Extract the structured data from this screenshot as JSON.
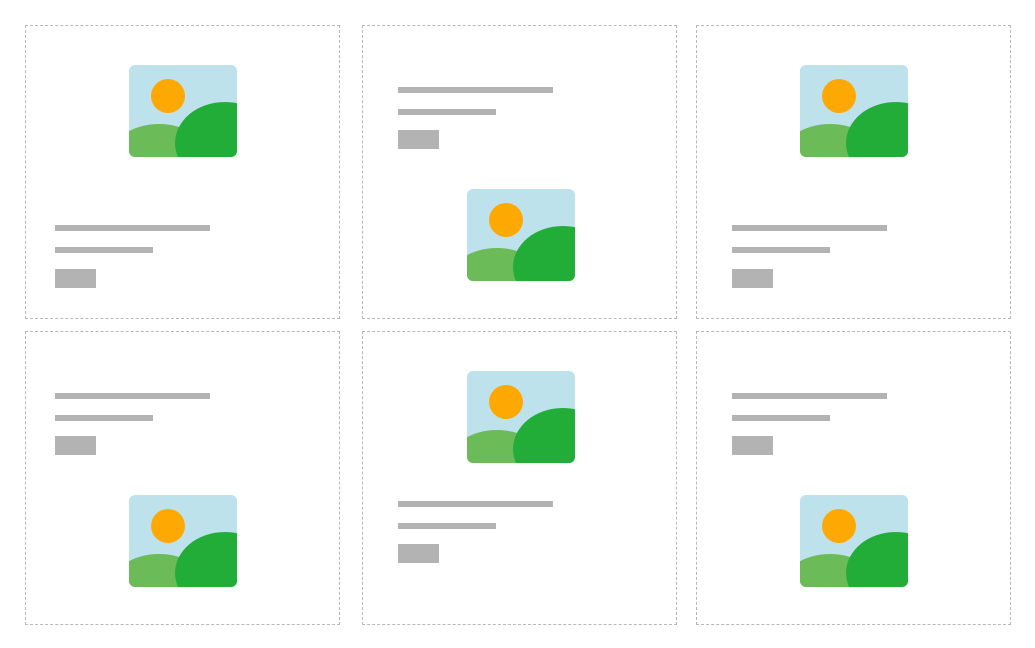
{
  "colors": {
    "border": "#b8b8b8",
    "placeholder_gray": "#b3b3b3",
    "sky": "#bde2eb",
    "sun": "#fea803",
    "hill_light": "#6cbb59",
    "hill_dark": "#22ad39"
  },
  "cards": [
    {
      "id": "card-1",
      "layout": "image-top",
      "image_icon": "landscape-image-icon",
      "text_placeholders": 2,
      "button_placeholder": true
    },
    {
      "id": "card-2",
      "layout": "image-bottom",
      "image_icon": "landscape-image-icon",
      "text_placeholders": 2,
      "button_placeholder": true
    },
    {
      "id": "card-3",
      "layout": "image-top",
      "image_icon": "landscape-image-icon",
      "text_placeholders": 2,
      "button_placeholder": true
    },
    {
      "id": "card-4",
      "layout": "image-bottom",
      "image_icon": "landscape-image-icon",
      "text_placeholders": 2,
      "button_placeholder": true
    },
    {
      "id": "card-5",
      "layout": "image-top",
      "image_icon": "landscape-image-icon",
      "text_placeholders": 2,
      "button_placeholder": true
    },
    {
      "id": "card-6",
      "layout": "image-bottom",
      "image_icon": "landscape-image-icon",
      "text_placeholders": 2,
      "button_placeholder": true
    }
  ]
}
